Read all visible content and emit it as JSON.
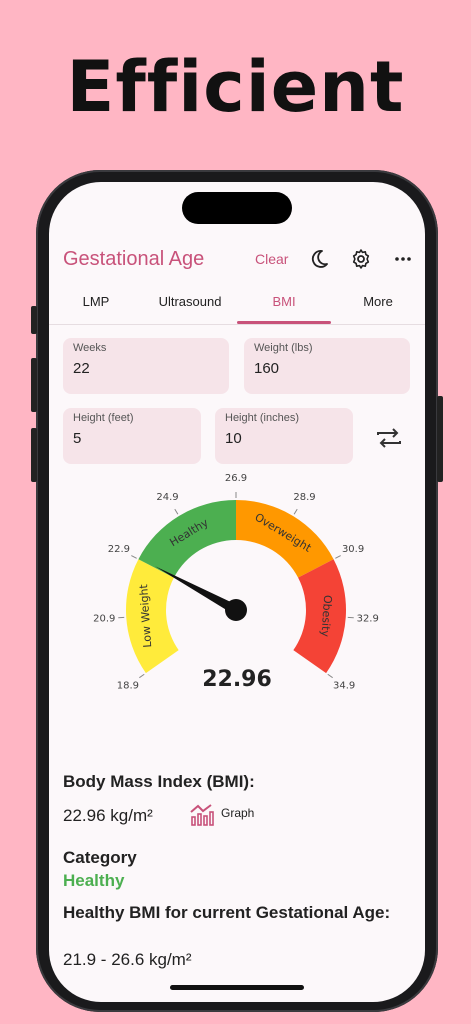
{
  "headline": "Efficient",
  "app": {
    "title": "Gestational Age",
    "clear_label": "Clear"
  },
  "tabs": [
    {
      "label": "LMP"
    },
    {
      "label": "Ultrasound"
    },
    {
      "label": "BMI"
    },
    {
      "label": "More"
    }
  ],
  "active_tab": "BMI",
  "inputs": {
    "weeks": {
      "label": "Weeks",
      "value": "22"
    },
    "weight": {
      "label": "Weight (lbs)",
      "value": "160"
    },
    "height_feet": {
      "label": "Height (feet)",
      "value": "5"
    },
    "height_inches": {
      "label": "Height (inches)",
      "value": "10"
    }
  },
  "gauge": {
    "value_text": "22.96",
    "value": 22.96,
    "min": 18.9,
    "max": 34.9,
    "ticks": [
      "18.9",
      "20.9",
      "22.9",
      "24.9",
      "26.9",
      "28.9",
      "30.9",
      "32.9",
      "34.9"
    ],
    "ranges": [
      {
        "label": "Low Weight",
        "from": 18.9,
        "to": 22.9,
        "color": "#ffeb3b"
      },
      {
        "label": "Healthy",
        "from": 22.9,
        "to": 26.9,
        "color": "#4caf50"
      },
      {
        "label": "Overweight",
        "from": 26.9,
        "to": 30.9,
        "color": "#ff9800"
      },
      {
        "label": "Obesity",
        "from": 30.9,
        "to": 34.9,
        "color": "#f44336"
      }
    ]
  },
  "results": {
    "bmi_heading": "Body Mass Index (BMI):",
    "bmi_value": "22.96 kg/m²",
    "graph_label": "Graph",
    "category_heading": "Category",
    "category_value": "Healthy",
    "healthy_heading": "Healthy BMI for current Gestational Age:",
    "healthy_range": "21.9 - 26.6 kg/m²"
  },
  "colors": {
    "accent": "#c8527a",
    "background": "#ffb6c4",
    "field": "#f6e4e9",
    "healthy": "#4caf50"
  },
  "icons": [
    "moon-icon",
    "gear-icon",
    "more-icon",
    "swap-icon",
    "graph-icon"
  ]
}
